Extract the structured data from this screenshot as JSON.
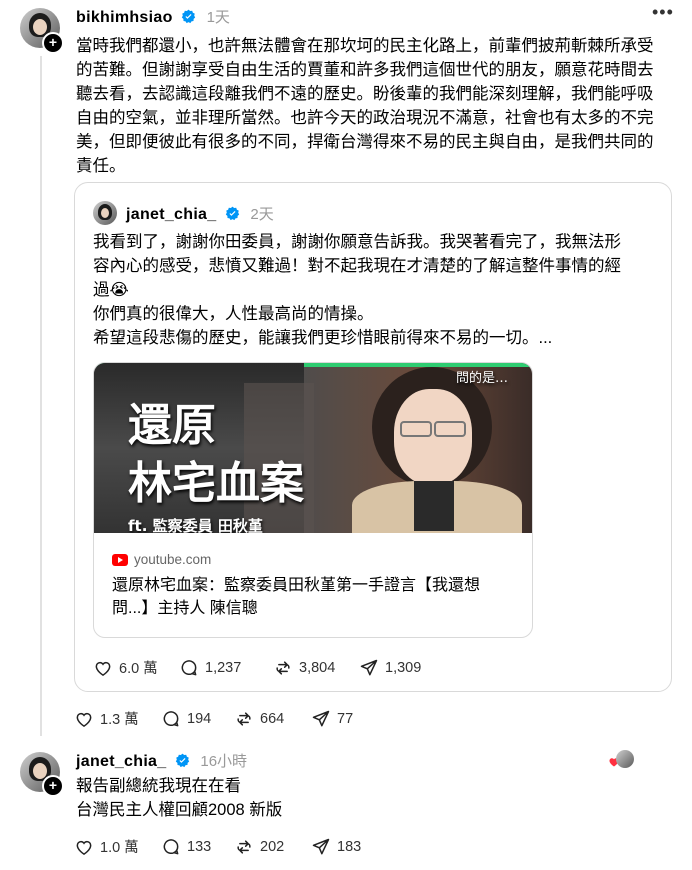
{
  "post1": {
    "username": "bikhimhsiao",
    "time": "1天",
    "lines": [
      "當時我們都還小，也許無法體會在那坎坷的民主化路上，前輩們披荊斬棘所承受",
      "的苦難。但謝謝享受自由生活的賈董和許多我們這個世代的朋友，願意花時間去",
      "聽去看，去認識這段離我們不遠的歷史。盼後輩的我們能深刻理解，我們能呼吸",
      "自由的空氣，並非理所當然。也許今天的政治現況不滿意，社會也有太多的不完",
      "美，但即便彼此有很多的不同，捍衛台灣得來不易的民主與自由，是我們共同的",
      "責任。"
    ],
    "likes": "1.3 萬",
    "comments": "194",
    "reposts": "664",
    "shares": "77"
  },
  "quote": {
    "username": "janet_chia_",
    "time": "2天",
    "lines": [
      "我看到了，謝謝你田委員，謝謝你願意告訴我。我哭著看完了，我無法形",
      "容內心的感受，悲憤又難過！對不起我現在才清楚的了解這整件事情的經",
      "過😭",
      "你們真的很偉大，人性最高尚的情操。",
      "希望這段悲傷的歷史，能讓我們更珍惜眼前得來不易的一切。..."
    ],
    "thumb": {
      "title_line1": "還原",
      "title_line2": "林宅血案",
      "subtitle": "ft. 監察委員 田秋堇",
      "corner_text": "問的是…"
    },
    "link_source": "youtube.com",
    "link_title_line1": "還原林宅血案：監察委員田秋堇第一手證言【我還想",
    "link_title_line2": "問...】主持人 陳信聰",
    "likes": "6.0 萬",
    "comments": "1,237",
    "reposts": "3,804",
    "shares": "1,309"
  },
  "post2": {
    "username": "janet_chia_",
    "time": "16小時",
    "lines": [
      "報告副總統我現在在看",
      "台灣民主人權回顧2008 新版"
    ],
    "likes": "1.0 萬",
    "comments": "133",
    "reposts": "202",
    "shares": "183"
  },
  "colors": {
    "verified": "#0095f6",
    "muted": "#999999",
    "border": "#d9d9d9",
    "heart": "#ff3040"
  },
  "icons": [
    "verified-badge-icon",
    "more-icon",
    "heart-icon",
    "comment-icon",
    "repost-icon",
    "share-icon",
    "youtube-icon",
    "follow-plus-icon"
  ]
}
